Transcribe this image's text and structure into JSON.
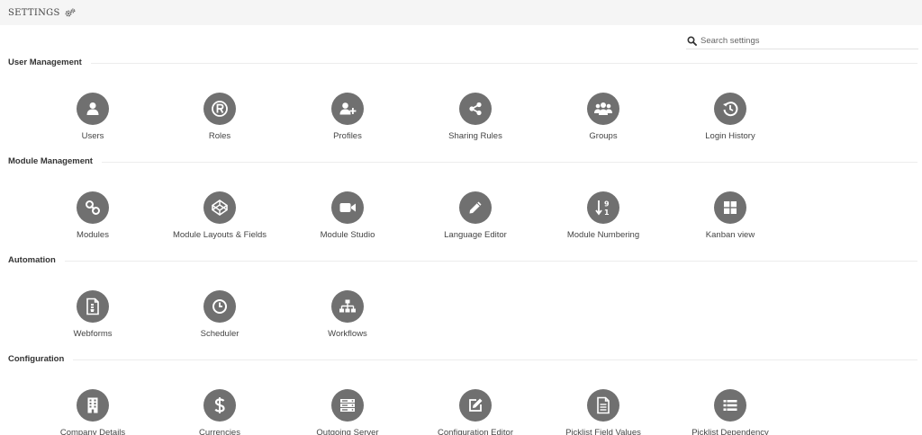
{
  "header": {
    "title": "SETTINGS",
    "icon": "gears-icon"
  },
  "search": {
    "placeholder": "Search settings",
    "icon": "search-icon"
  },
  "sections": [
    {
      "title": "User Management",
      "items": [
        {
          "label": "Users",
          "icon": "user-icon"
        },
        {
          "label": "Roles",
          "icon": "registered-icon"
        },
        {
          "label": "Profiles",
          "icon": "user-plus-icon"
        },
        {
          "label": "Sharing Rules",
          "icon": "share-icon"
        },
        {
          "label": "Groups",
          "icon": "users-group-icon"
        },
        {
          "label": "Login History",
          "icon": "history-icon"
        }
      ]
    },
    {
      "title": "Module Management",
      "items": [
        {
          "label": "Modules",
          "icon": "link-icon"
        },
        {
          "label": "Module Layouts & Fields",
          "icon": "codepen-icon"
        },
        {
          "label": "Module Studio",
          "icon": "video-camera-icon"
        },
        {
          "label": "Language Editor",
          "icon": "pencil-icon"
        },
        {
          "label": "Module Numbering",
          "icon": "sort-numeric-icon"
        },
        {
          "label": "Kanban view",
          "icon": "grid-icon"
        }
      ]
    },
    {
      "title": "Automation",
      "items": [
        {
          "label": "Webforms",
          "icon": "file-code-icon"
        },
        {
          "label": "Scheduler",
          "icon": "clock-icon"
        },
        {
          "label": "Workflows",
          "icon": "sitemap-icon"
        }
      ]
    },
    {
      "title": "Configuration",
      "items": [
        {
          "label": "Company Details",
          "icon": "building-icon"
        },
        {
          "label": "Currencies",
          "icon": "dollar-icon"
        },
        {
          "label": "Outgoing Server",
          "icon": "server-icon"
        },
        {
          "label": "Configuration Editor",
          "icon": "edit-icon"
        },
        {
          "label": "Picklist Field Values",
          "icon": "file-text-icon"
        },
        {
          "label": "Picklist Dependency",
          "icon": "list-icon"
        }
      ]
    }
  ],
  "colors": {
    "icon_circle": "#707070",
    "topbar": "#f5f5f5",
    "divider": "#ececec"
  }
}
